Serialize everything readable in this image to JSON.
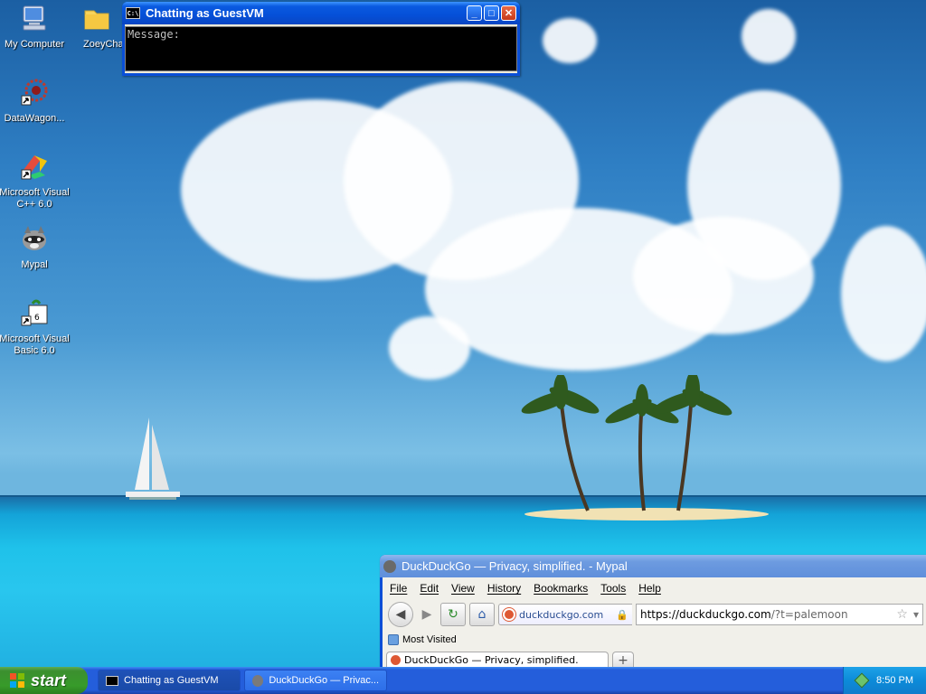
{
  "desktop": {
    "icons": [
      {
        "label": "My Computer",
        "icon": "computer-icon"
      },
      {
        "label": "ZoeyCha",
        "icon": "folder-icon"
      },
      {
        "label": "DataWagon...",
        "icon": "datawagon-icon"
      },
      {
        "label": "Microsoft Visual C++ 6.0",
        "icon": "visual-cpp-icon"
      },
      {
        "label": "Mypal",
        "icon": "mypal-raccoon-icon"
      },
      {
        "label": "Microsoft Visual Basic 6.0",
        "icon": "visual-basic-icon"
      }
    ]
  },
  "chat_window": {
    "title": "Chatting as GuestVM",
    "console_text": "Message:"
  },
  "browser_window": {
    "title": "DuckDuckGo — Privacy, simplified. - Mypal",
    "menu": [
      "File",
      "Edit",
      "View",
      "History",
      "Bookmarks",
      "Tools",
      "Help"
    ],
    "site_identity": "duckduckgo.com",
    "url_host": "https://duckduckgo.com",
    "url_rest": "/?t=palemoon",
    "bookmark": "Most Visited",
    "tab_title": "DuckDuckGo — Privacy, simplified."
  },
  "taskbar": {
    "start_label": "start",
    "buttons": [
      {
        "label": "Chatting as GuestVM"
      },
      {
        "label": "DuckDuckGo — Privac..."
      }
    ],
    "clock": "8:50 PM"
  },
  "colors": {
    "titlebar_blue": "#0a5ae0",
    "start_green": "#3c8f2f",
    "taskbar_blue": "#245edb"
  }
}
